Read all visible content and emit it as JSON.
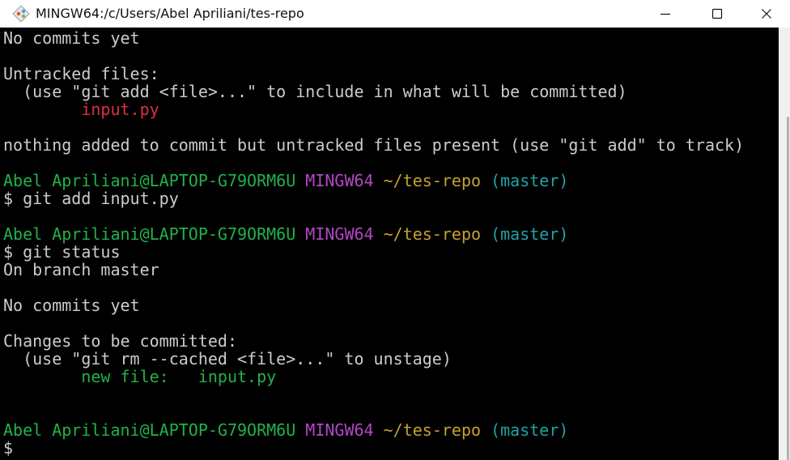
{
  "window": {
    "title": "MINGW64:/c/Users/Abel Apriliani/tes-repo",
    "app_icon": "git-diamond-icon",
    "controls": [
      "minimize-icon",
      "maximize-icon",
      "close-icon"
    ]
  },
  "colors": {
    "background": "#000000",
    "default_text": "#cccccc",
    "red": "#d9313e",
    "green": "#20b24a",
    "magenta": "#b346c6",
    "yellow": "#c6a22d",
    "cyan": "#20a3a8"
  },
  "terminal": {
    "line1": "No commits yet",
    "line2": "Untracked files:",
    "line3": "  (use \"git add <file>...\" to include in what will be committed)",
    "line4_file": "input.py",
    "line5": "nothing added to commit but untracked files present (use \"git add\" to track)",
    "prompt1": {
      "user": "Abel Apriliani@LAPTOP-G79ORM6U",
      "shell": "MINGW64",
      "path": "~/tes-repo",
      "branch": "(master)"
    },
    "cmd1": "$ git add input.py",
    "prompt2": {
      "user": "Abel Apriliani@LAPTOP-G79ORM6U",
      "shell": "MINGW64",
      "path": "~/tes-repo",
      "branch": "(master)"
    },
    "cmd2": "$ git status",
    "line6": "On branch master",
    "line7": "No commits yet",
    "line8": "Changes to be committed:",
    "line9": "  (use \"git rm --cached <file>...\" to unstage)",
    "line10_label": "new file:",
    "line10_file": "input.py",
    "prompt3": {
      "user": "Abel Apriliani@LAPTOP-G79ORM6U",
      "shell": "MINGW64",
      "path": "~/tes-repo",
      "branch": "(master)"
    },
    "cmd3": "$"
  }
}
